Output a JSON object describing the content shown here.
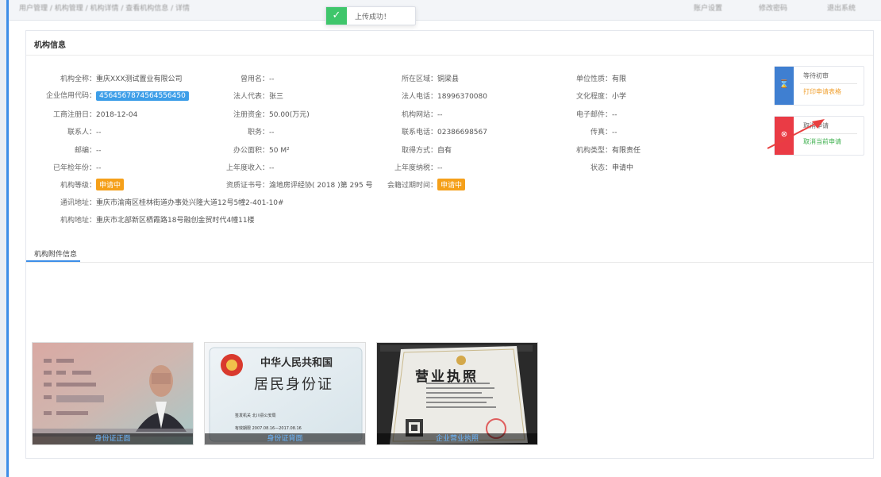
{
  "topbar": {
    "breadcrumb": "用户管理 / 机构管理 / 机构详情 / 查看机构信息 / 详情",
    "right_items": [
      "账户设置",
      "修改密码",
      "退出系统"
    ]
  },
  "toast": {
    "message": "上传成功！"
  },
  "panel": {
    "title": "机构信息"
  },
  "fields": {
    "full_name": {
      "label": "机构全称：",
      "value": "重庆XXX测试置业有限公司"
    },
    "used_name": {
      "label": "曾用名：",
      "value": "--"
    },
    "region": {
      "label": "所在区域：",
      "value": "铜梁县"
    },
    "unit_nature": {
      "label": "单位性质：",
      "value": "有限"
    },
    "credit_code": {
      "label": "企业信用代码：",
      "value": "4564567874564556450"
    },
    "legal_rep": {
      "label": "法人代表：",
      "value": "张三"
    },
    "legal_phone": {
      "label": "法人电话：",
      "value": "18996370080"
    },
    "education": {
      "label": "文化程度：",
      "value": "小学"
    },
    "reg_date": {
      "label": "工商注册日：",
      "value": "2018-12-04"
    },
    "reg_capital": {
      "label": "注册资金：",
      "value": "50.00(万元)"
    },
    "website": {
      "label": "机构网站：",
      "value": "--"
    },
    "email": {
      "label": "电子邮件：",
      "value": "--"
    },
    "contact": {
      "label": "联系人：",
      "value": "--"
    },
    "position": {
      "label": "职务：",
      "value": "--"
    },
    "contact_phone": {
      "label": "联系电话：",
      "value": "02386698567"
    },
    "fax": {
      "label": "传真：",
      "value": "--"
    },
    "postcode": {
      "label": "邮编：",
      "value": "--"
    },
    "office_area": {
      "label": "办公面积：",
      "value": "50 M²"
    },
    "acquire_method": {
      "label": "取得方式：",
      "value": "自有"
    },
    "org_type": {
      "label": "机构类型：",
      "value": "有限责任"
    },
    "inspected_year": {
      "label": "已年检年份：",
      "value": "--"
    },
    "last_income": {
      "label": "上年度收入：",
      "value": "--"
    },
    "last_tax": {
      "label": "上年度纳税：",
      "value": "--"
    },
    "status": {
      "label": "状态：",
      "value": "申请中"
    },
    "org_level": {
      "label": "机构等级：",
      "value": "申请中"
    },
    "cert_no": {
      "label": "资质证书号：",
      "value": "渝地房评经协( 2018 )第 295 号"
    },
    "member_expire": {
      "label": "会籍过期时间：",
      "value": "申请中"
    },
    "mail_addr": {
      "label": "通讯地址：",
      "value": "重庆市渝南区桂林街道办事处兴隆大道12号5幢2-401-10#"
    },
    "org_addr": {
      "label": "机构地址：",
      "value": "重庆市北部新区栖霞路18号融创金贸时代4幢11楼"
    }
  },
  "action_cards": {
    "waiting": {
      "title": "等待初审",
      "action": "打印申请表格"
    },
    "cancel": {
      "title": "取消申请",
      "action": "取消当前申请"
    }
  },
  "attachments": {
    "tab_label": "机构附件信息",
    "items": [
      {
        "caption": "身份证正面"
      },
      {
        "caption": "身份证背面"
      },
      {
        "caption": "企业营业执照"
      }
    ],
    "idcard_back": {
      "line1": "中华人民共和国",
      "line2": "居民身份证",
      "authority": "签发机关  北川县公安局",
      "validity": "有效期限  2007.08.16—2017.08.16"
    },
    "license": {
      "title": "营业执照"
    }
  },
  "colors": {
    "accent": "#3d8ee8",
    "success": "#3fc66b",
    "warning": "#f5a01a",
    "danger": "#ea3b45",
    "link_orange": "#f0a030",
    "link_green": "#3fb04f"
  }
}
